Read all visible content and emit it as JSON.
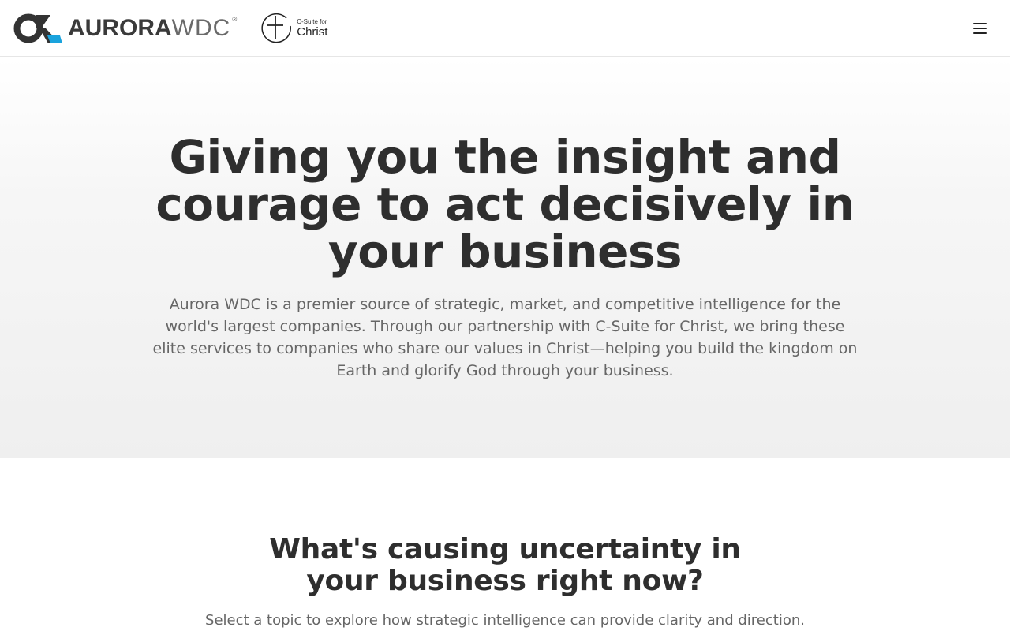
{
  "header": {
    "aurora_logo": {
      "word_bold": "AURORA",
      "word_light": "WDC",
      "registered": "®",
      "icon": "aurora-wdc-logo-icon",
      "accent_color": "#1aa3dd"
    },
    "partner_logo": {
      "small_text": "C-Suite for",
      "big_text": "Christ",
      "icon": "cross-circle-icon"
    },
    "menu": {
      "icon": "hamburger-menu-icon"
    }
  },
  "hero": {
    "title": "Giving you the insight and courage to act decisively in your business",
    "description": "Aurora WDC is a premier source of strategic, market, and competitive intelligence for the world's largest companies. Through our partnership with C-Suite for Christ, we bring these elite services to companies who share our values in Christ—helping you build the kingdom on Earth and glorify God through your business."
  },
  "uncertainty": {
    "heading": "What's causing uncertainty in your business right now?",
    "subheading": "Select a topic to explore how strategic intelligence can provide clarity and direction."
  }
}
